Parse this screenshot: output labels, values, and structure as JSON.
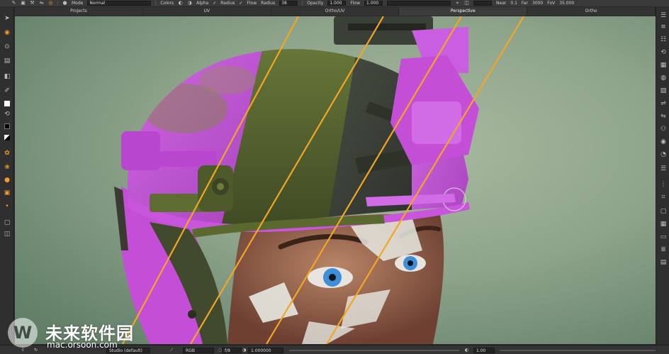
{
  "toolbar": {
    "mode_label": "Mode",
    "mode_value": "Normal",
    "colors_label": "Colors",
    "alpha_label": "Alpha",
    "radius_label": "Radius",
    "flow_label": "Flow",
    "radius_field_label": "Radius",
    "radius_value": "38",
    "opacity_label": "Opacity",
    "opacity_value": "1.000",
    "flow_field_label": "Flow",
    "flow_value": "1.000",
    "near_label": "Near",
    "near_value": "0.1",
    "far_label": "Far",
    "far_value": "3000",
    "fov_label": "FoV",
    "fov_value": "35.000",
    "check_mark": "✓"
  },
  "tabs": [
    "Projects",
    "UV",
    "Ortho/UV",
    "Perspective",
    "Ortho"
  ],
  "active_tab": "Perspective",
  "bottombar": {
    "shader_value": "Studio (default)",
    "channel_value": "RGB",
    "fstop_value": "f/8",
    "exposure_value": "1.000000",
    "gamma_value": "1.00"
  },
  "watermark": {
    "logo_letter": "W",
    "title": "未来软件园",
    "url": "mac.orsoon.com"
  },
  "icons": {
    "left": [
      "select-arrow-icon",
      "paint-brush-icon",
      "clone-icon",
      "smear-icon",
      "eraser-icon",
      "transform-icon",
      "pen-icon",
      "swap-color-icon",
      "foreground-color-swatch",
      "background-color-swatch",
      "bw-color-swatch",
      "paint-bucket-icon",
      "blur-icon",
      "sphere-icon",
      "gradient-icon",
      "marker-icon",
      "square-select-icon",
      "lasso-icon"
    ],
    "right": [
      "menu-icon",
      "layers-icon",
      "list-icon",
      "history-icon",
      "palette-icon",
      "brush-settings-icon",
      "image-manager-icon",
      "shader-icon",
      "lighting-icon",
      "camera-icon",
      "materials-icon",
      "texture-icon",
      "channels-icon",
      "grid-icon",
      "locator-icon",
      "viewport-icon",
      "window-icon"
    ]
  },
  "colors": {
    "accent": "#f39a2a",
    "toolbar_bg": "#3a3a3a",
    "viewport_bg": "#8ea48b",
    "helmet_pink": "#c44fd6",
    "helmet_green": "#5b6d32",
    "helmet_black": "#3b4038",
    "guide_lines": "#f2a623"
  }
}
